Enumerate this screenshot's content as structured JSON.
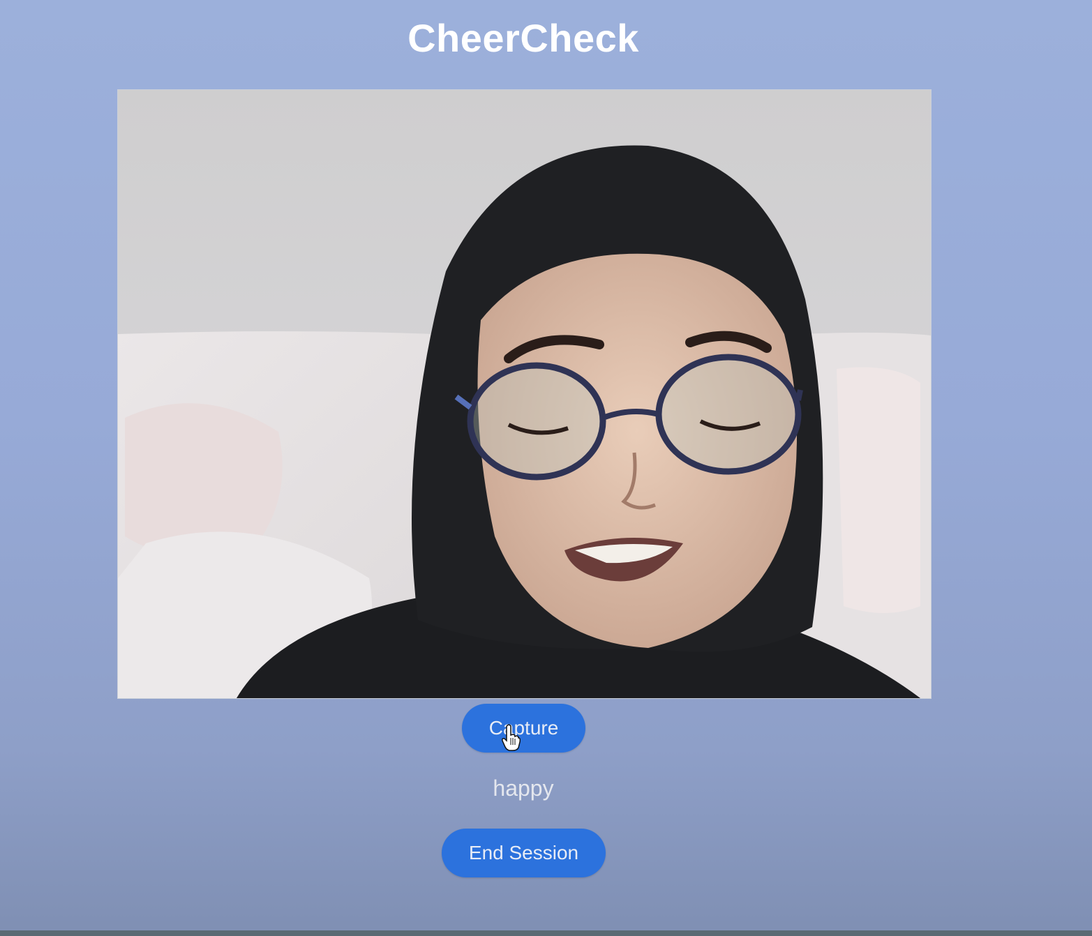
{
  "app": {
    "title": "CheerCheck"
  },
  "camera": {
    "feed": "webcam-video-feed"
  },
  "controls": {
    "capture_label": "Capture",
    "end_session_label": "End Session"
  },
  "result": {
    "emotion": "happy"
  },
  "icons": {
    "cursor": "hand-pointer-icon"
  },
  "colors": {
    "background": "#9cb0db",
    "button": "#2c72dd",
    "title": "#ffffff"
  }
}
